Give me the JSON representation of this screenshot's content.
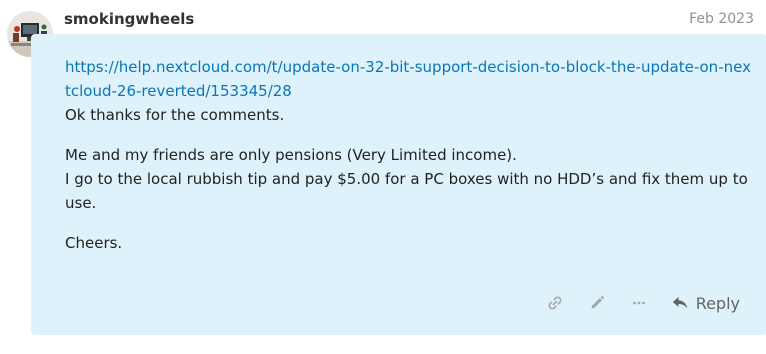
{
  "post": {
    "username": "smokingwheels",
    "date": "Feb 2023",
    "avatar_icon": "avatar-photo",
    "link_url": "https://help.nextcloud.com/t/update-on-32-bit-support-decision-to-block-the-update-on-nextcloud-26-reverted/153345/28",
    "line_1": "Ok thanks for the comments.",
    "paragraph_2_line_1": "Me and my friends are only pensions (Very Limited income).",
    "paragraph_2_line_2": "I go to the local rubbish tip and pay $5.00 for a PC boxes with no HDD’s and fix them up to use.",
    "paragraph_3": "Cheers."
  },
  "actions": {
    "copy_link_icon": "link-icon",
    "edit_icon": "pencil-icon",
    "more_icon": "ellipsis-icon",
    "reply_icon": "reply-arrow-icon",
    "reply_label": "Reply"
  },
  "colors": {
    "bubble_background": "#def2fc",
    "link": "#0a76b7",
    "muted": "#919191"
  }
}
